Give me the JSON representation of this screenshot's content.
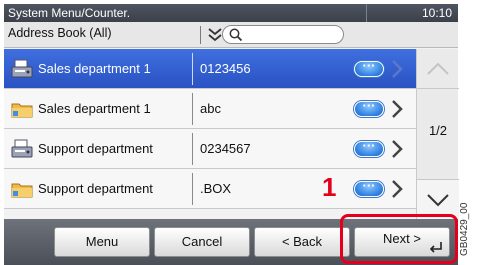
{
  "titlebar": {
    "title": "System Menu/Counter.",
    "clock": "10:10"
  },
  "filter": {
    "address_book_label": "Address Book (All)",
    "search_placeholder": ""
  },
  "rows": [
    {
      "name": "Sales department 1",
      "value": "0123456",
      "icon": "fax-icon",
      "selected": true
    },
    {
      "name": "Sales department 1",
      "value": "abc",
      "icon": "folder-icon",
      "selected": false
    },
    {
      "name": "Support department",
      "value": "0234567",
      "icon": "fax-icon",
      "selected": false
    },
    {
      "name": "Support department",
      "value": ".BOX",
      "icon": "folder-icon",
      "selected": false
    }
  ],
  "pager": {
    "indicator": "1/2"
  },
  "buttons": {
    "menu": "Menu",
    "cancel": "Cancel",
    "back": "< Back",
    "next": "Next >"
  },
  "callout": {
    "number": "1"
  },
  "figure_code": "GB0429_00",
  "colors": {
    "selected_row": "#2f5fd4",
    "callout": "#e4001b",
    "titlebar": "#434852"
  }
}
